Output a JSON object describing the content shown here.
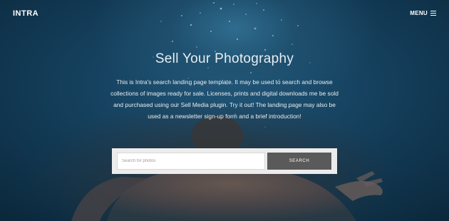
{
  "header": {
    "logo": "INTRA",
    "menu_label": "MENU"
  },
  "hero": {
    "title": "Sell Your Photography",
    "intro": "This is Intra's search landing page template. It may be used to search and browse collections of images ready for sale. Licenses, prints and digital downloads me be sold and purchased using our Sell Media plugin. Try it out! The landing page may also be used as a newsletter sign-up form and a brief introduction!"
  },
  "search": {
    "placeholder": "Search for photos",
    "button_label": "SEARCH"
  },
  "icons": {
    "menu": "hamburger-menu-icon"
  }
}
